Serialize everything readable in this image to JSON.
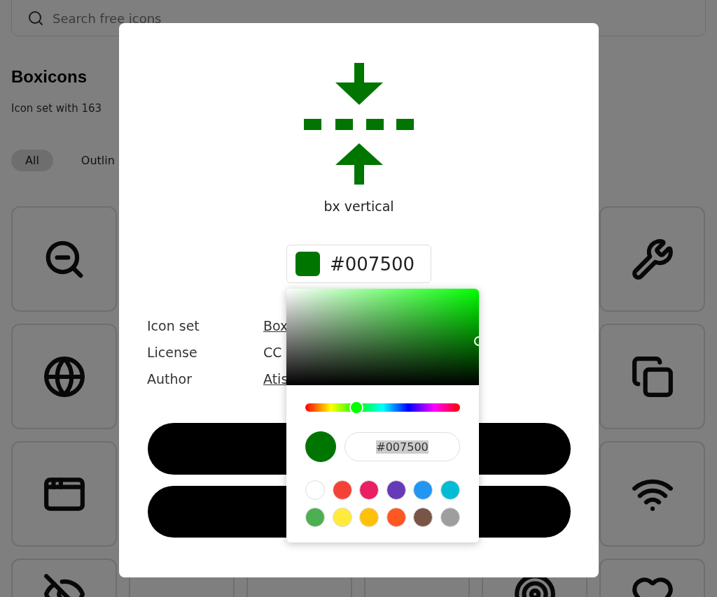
{
  "search": {
    "placeholder": "Search free icons"
  },
  "header": {
    "title": "Boxicons",
    "subtitle": "Icon set with 163"
  },
  "filter_tabs": [
    {
      "label": "All",
      "selected": true
    },
    {
      "label": "Outlin",
      "selected": false
    }
  ],
  "modal": {
    "icon": {
      "color": "#007500"
    },
    "icon_name": "bx vertical",
    "color_button": {
      "swatch": {
        "color": "#007500"
      },
      "value": "#007500"
    },
    "info": [
      {
        "label": "Icon set",
        "value": "Box",
        "link": true
      },
      {
        "label": "License",
        "value": "CC",
        "link": false
      },
      {
        "label": "Author",
        "value": "Atis",
        "link": true
      }
    ],
    "buttons": [
      {
        "kind": "pill"
      },
      {
        "kind": "pill"
      }
    ]
  },
  "picker": {
    "hue": {
      "color": "#00ff00"
    },
    "hue_slider": {
      "level": 0.33
    },
    "preview": {
      "color": "#007500"
    },
    "hex_value": "#007500",
    "swatches": [
      {
        "color": "#ffffff"
      },
      {
        "color": "#f44336"
      },
      {
        "color": "#e91e63"
      },
      {
        "color": "#673ab7"
      },
      {
        "color": "#2196f3"
      },
      {
        "color": "#00bcd4"
      },
      {
        "color": "#4caf50"
      },
      {
        "color": "#ffeb3b"
      },
      {
        "color": "#ffc107"
      },
      {
        "color": "#ff5722"
      },
      {
        "color": "#795548"
      },
      {
        "color": "#9e9e9e"
      }
    ]
  }
}
